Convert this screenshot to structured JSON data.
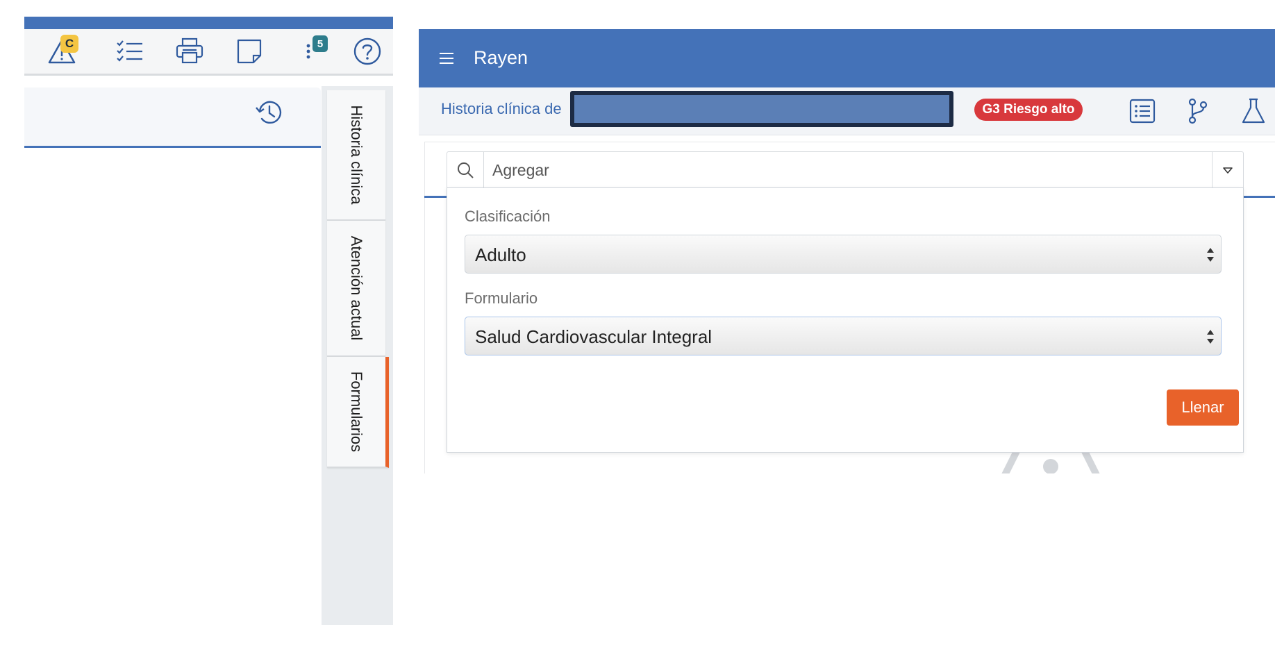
{
  "left_panel": {
    "toolbar": {
      "alert_badge": "C",
      "more_badge": "5",
      "icons": [
        "warning-icon",
        "checklist-icon",
        "printer-icon",
        "note-icon",
        "more-vertical-icon",
        "help-icon"
      ]
    },
    "history_icon": "history-icon",
    "side_tabs": [
      {
        "label": "Historia clínica"
      },
      {
        "label": "Atención actual"
      },
      {
        "label": "Formularios"
      }
    ]
  },
  "app": {
    "title": "Rayen"
  },
  "patient": {
    "label": "Historia clínica de",
    "risk_badge": "G3 Riesgo alto"
  },
  "search": {
    "placeholder": "Agregar"
  },
  "form": {
    "classification_label": "Clasificación",
    "classification_value": "Adulto",
    "form_label": "Formulario",
    "form_value": "Salud Cardiovascular Integral",
    "fill_button": "Llenar"
  },
  "colors": {
    "header_blue": "#4472b8",
    "accent_orange": "#e8622a",
    "risk_red": "#d8383c",
    "badge_yellow": "#f4c542"
  }
}
